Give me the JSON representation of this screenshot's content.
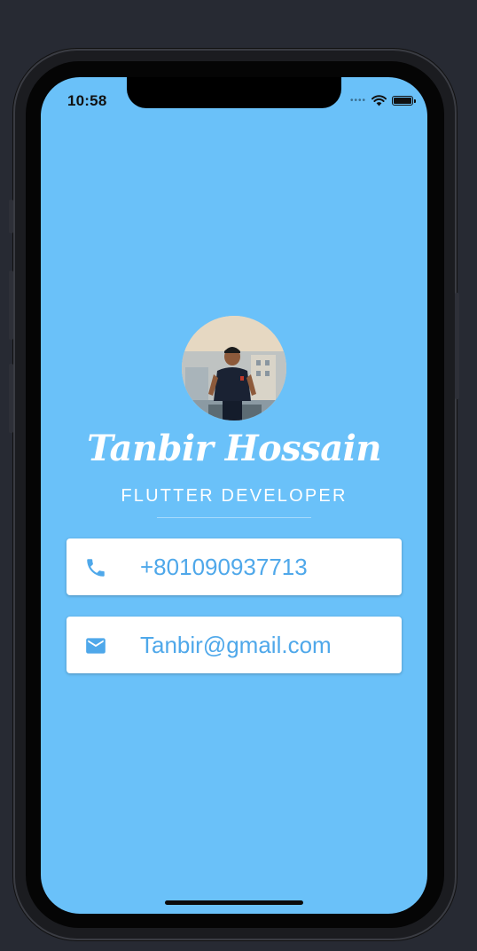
{
  "status_bar": {
    "time": "10:58",
    "icons": [
      "signal-dots-icon",
      "wifi-icon",
      "battery-icon"
    ]
  },
  "profile": {
    "name": "Tanbir Hossain",
    "role": "FLUTTER DEVELOPER",
    "avatar_icon": "profile-photo"
  },
  "contacts": [
    {
      "icon": "phone-icon",
      "value": "+801090937713"
    },
    {
      "icon": "email-icon",
      "value": "Tanbir@gmail.com"
    }
  ],
  "colors": {
    "background": "#6ac1f9",
    "card": "#ffffff",
    "accent_text": "#4fa8ea",
    "page_bg": "#272a33"
  }
}
